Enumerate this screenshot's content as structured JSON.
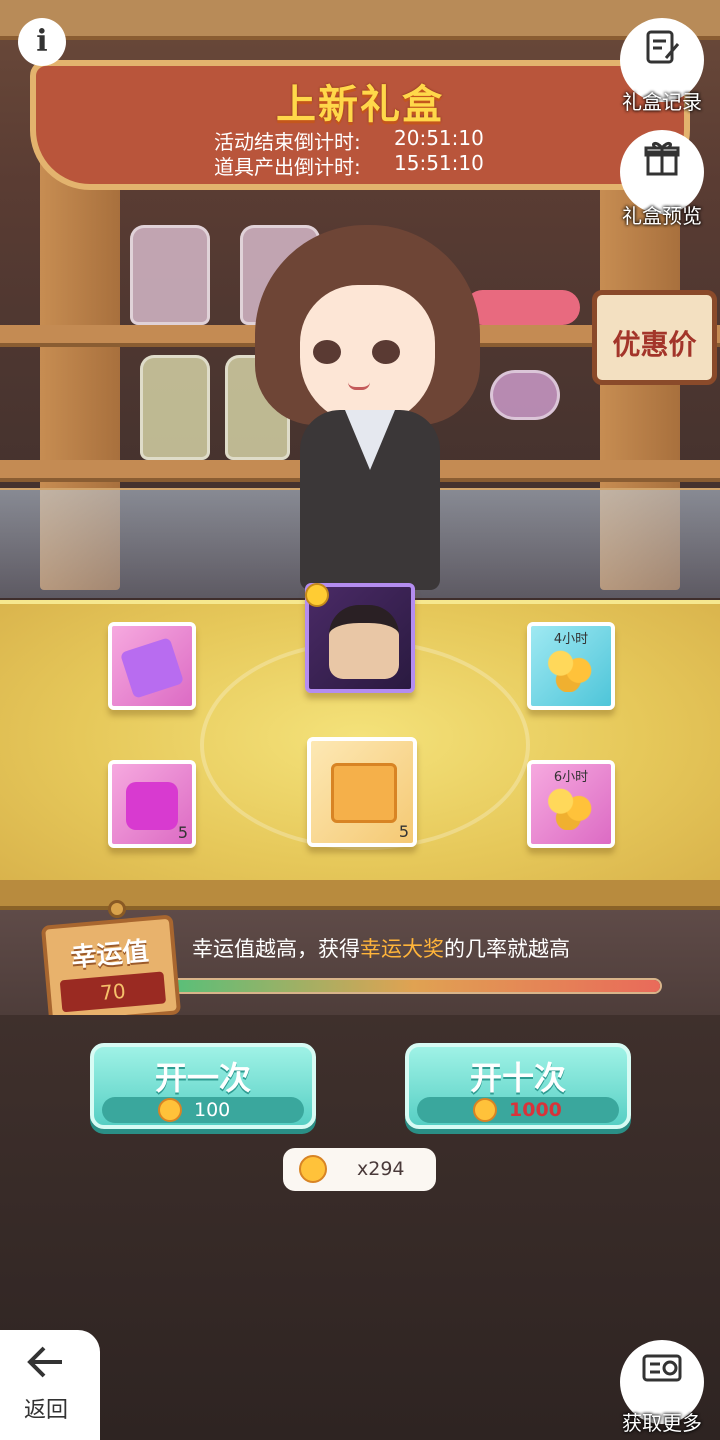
{
  "header": {
    "title": "上新礼盒",
    "activity_end_label": "活动结束倒计时:",
    "activity_end_value": "20:51:10",
    "item_output_label": "道具产出倒计时:",
    "item_output_value": "15:51:10"
  },
  "top_right_buttons": {
    "record_label": "礼盒记录",
    "preview_label": "礼盒预览"
  },
  "discount_sign": "优惠价",
  "rewards": [
    {
      "id": "purple-bar",
      "caption": "",
      "qty": ""
    },
    {
      "id": "hero",
      "caption": "",
      "qty": ""
    },
    {
      "id": "coins-4h",
      "caption": "4小时",
      "qty": ""
    },
    {
      "id": "pink-box",
      "caption": "",
      "qty": "5"
    },
    {
      "id": "chest",
      "caption": "",
      "qty": "5"
    },
    {
      "id": "coins-6h",
      "caption": "6小时",
      "qty": ""
    }
  ],
  "luck": {
    "label": "幸运值",
    "value": "70",
    "text_prefix": "幸运值越高，获得",
    "text_highlight": "幸运大奖",
    "text_suffix": "的几率就越高",
    "progress_fraction": 1.0
  },
  "open_once": {
    "label": "开一次",
    "cost": "100"
  },
  "open_ten": {
    "label": "开十次",
    "cost": "1000"
  },
  "balance": "x294",
  "back_label": "返回",
  "get_more_label": "获取更多",
  "icons": {
    "info": "i",
    "record": "notepad-icon",
    "preview": "gift-icon",
    "back": "arrow-left-icon",
    "get_more": "ticket-icon"
  },
  "colors": {
    "accent_highlight": "#ffb43a",
    "title_yellow": "#ffd84a",
    "button_teal": "#57cfc4",
    "cost_red": "#d8333a"
  }
}
